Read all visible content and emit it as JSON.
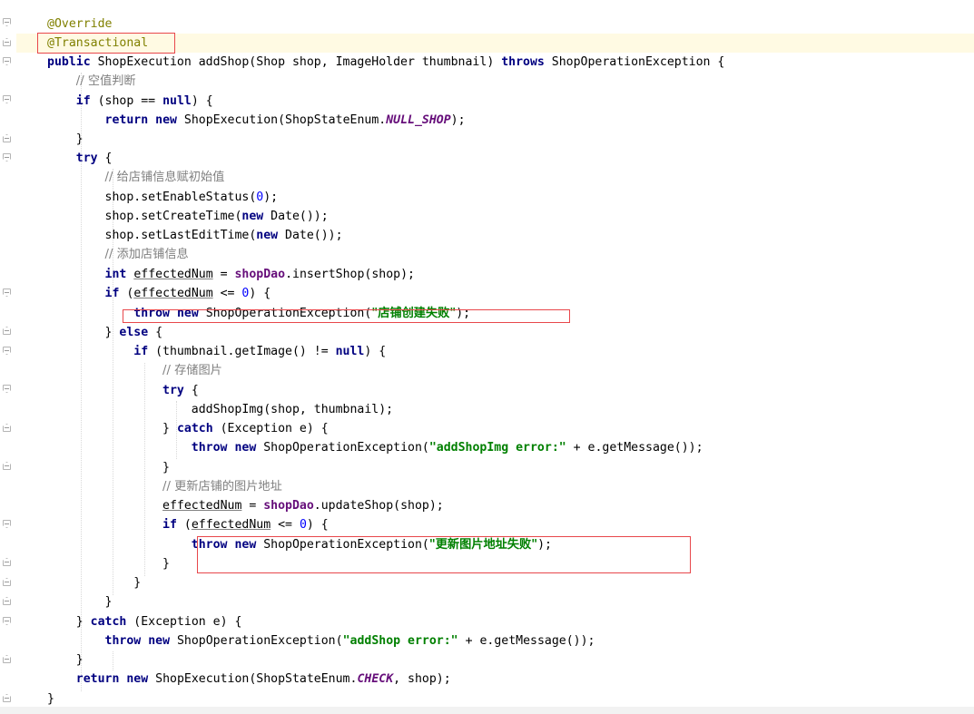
{
  "code": {
    "override": "@Override",
    "transactional": "@Transactional",
    "method_kw": "public",
    "method_sig": " ShopExecution addShop(Shop shop, ImageHolder thumbnail) ",
    "throws_kw": "throws",
    "method_tail": " ShopOperationException {",
    "c_null_check": "// 空值判断",
    "if1_kw": "if",
    "if1_mid": " (shop == ",
    "null1": "null",
    "if1_tail": ") {",
    "return_kw": "return",
    "new_kw": "new",
    "ret1_mid": " ShopExecution(ShopStateEnum.",
    "null_shop": "NULL_SHOP",
    "ret1_tail": ");",
    "close_brace": "}",
    "try_kw": "try",
    "try_tail": " {",
    "c_init": "// 给店铺信息赋初始值",
    "l_enable_a": "shop.setEnableStatus(",
    "zero": "0",
    "l_enable_b": ");",
    "l_create_a": "shop.setCreateTime(",
    "l_create_b": " Date());",
    "l_lastedit_a": "shop.setLastEditTime(",
    "l_lastedit_b": " Date());",
    "c_add": "// 添加店铺信息",
    "int_kw": "int",
    "effected_num": "effectedNum",
    "assign": " = ",
    "shop_dao": "shopDao",
    "insert_tail": ".insertShop(shop);",
    "if_open": " (",
    "le_zero": " <= ",
    "paren_brace": ") {",
    "throw_kw": "throw",
    "exc_call": " ShopOperationException(",
    "str_create_fail": "\"店铺创建失败\"",
    "stmt_end": ");",
    "else_a": "} ",
    "else_kw": "else",
    "else_b": " {",
    "if_thumb_mid": " (thumbnail.getImage() != ",
    "null2": "null",
    "c_store": "// 存储图片",
    "add_img": "addShopImg(shop, thumbnail);",
    "catch_a": "} ",
    "catch_kw": "catch",
    "catch_b": " (Exception e) {",
    "str_img_err": "\"addShopImg error:\"",
    "get_msg_tail": " + e.getMessage());",
    "c_update": "// 更新店铺的图片地址",
    "update_tail": ".updateShop(shop);",
    "str_update_fail": "\"更新图片地址失败\"",
    "str_add_err": "\"addShop error:\"",
    "ret2_mid": " ShopExecution(ShopStateEnum.",
    "check": "CHECK",
    "ret2_tail": ", shop);"
  },
  "colors": {
    "annotation": "#808000",
    "keyword": "#000080",
    "comment": "#808080",
    "string": "#008000",
    "number": "#0000ff",
    "field": "#660e7a",
    "highlight_box": "#e8474b",
    "current_line": "#fffae3"
  }
}
